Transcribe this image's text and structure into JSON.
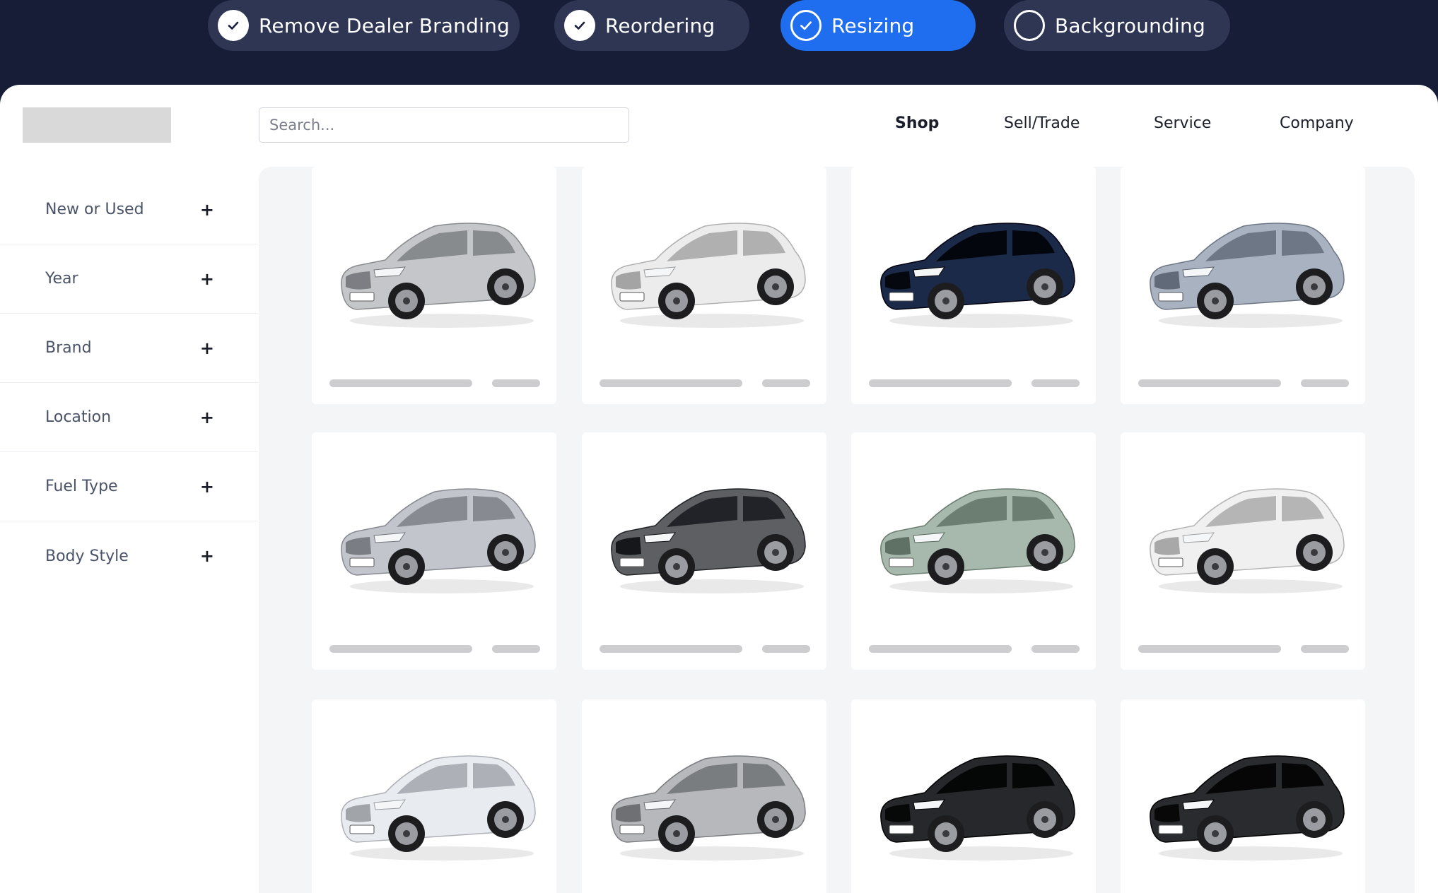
{
  "steps": [
    {
      "label": "Remove  Dealer Branding",
      "state": "done"
    },
    {
      "label": "Reordering",
      "state": "done"
    },
    {
      "label": "Resizing",
      "state": "active"
    },
    {
      "label": "Backgrounding",
      "state": "todo"
    }
  ],
  "search": {
    "placeholder": "Search..."
  },
  "nav": [
    {
      "label": "Shop"
    },
    {
      "label": "Sell/Trade"
    },
    {
      "label": "Service"
    },
    {
      "label": "Company"
    }
  ],
  "filters": [
    {
      "label": "New or Used",
      "toggle": "+"
    },
    {
      "label": "Year",
      "toggle": "+"
    },
    {
      "label": "Brand",
      "toggle": "+"
    },
    {
      "label": "Location",
      "toggle": "+"
    },
    {
      "label": "Fuel Type",
      "toggle": "+"
    },
    {
      "label": "Body Style",
      "toggle": "+"
    }
  ],
  "cars": [
    {
      "color": "#c4c6ca"
    },
    {
      "color": "#ececec"
    },
    {
      "color": "#1c2a4a"
    },
    {
      "color": "#a9b2c0"
    },
    {
      "color": "#c2c6cc"
    },
    {
      "color": "#5e5f63"
    },
    {
      "color": "#a7b8ad"
    },
    {
      "color": "#f0f0f0"
    },
    {
      "color": "#e8ecf1"
    },
    {
      "color": "#b6b8bc"
    },
    {
      "color": "#26282c"
    },
    {
      "color": "#2a2b2f"
    }
  ],
  "colors": {
    "header_bg": "#171d36",
    "step_done_bg": "#2e3654",
    "step_active_bg": "#1f6ef0",
    "placeholder_bar": "#cdcdd0",
    "listing_bg": "#f4f5f7"
  }
}
